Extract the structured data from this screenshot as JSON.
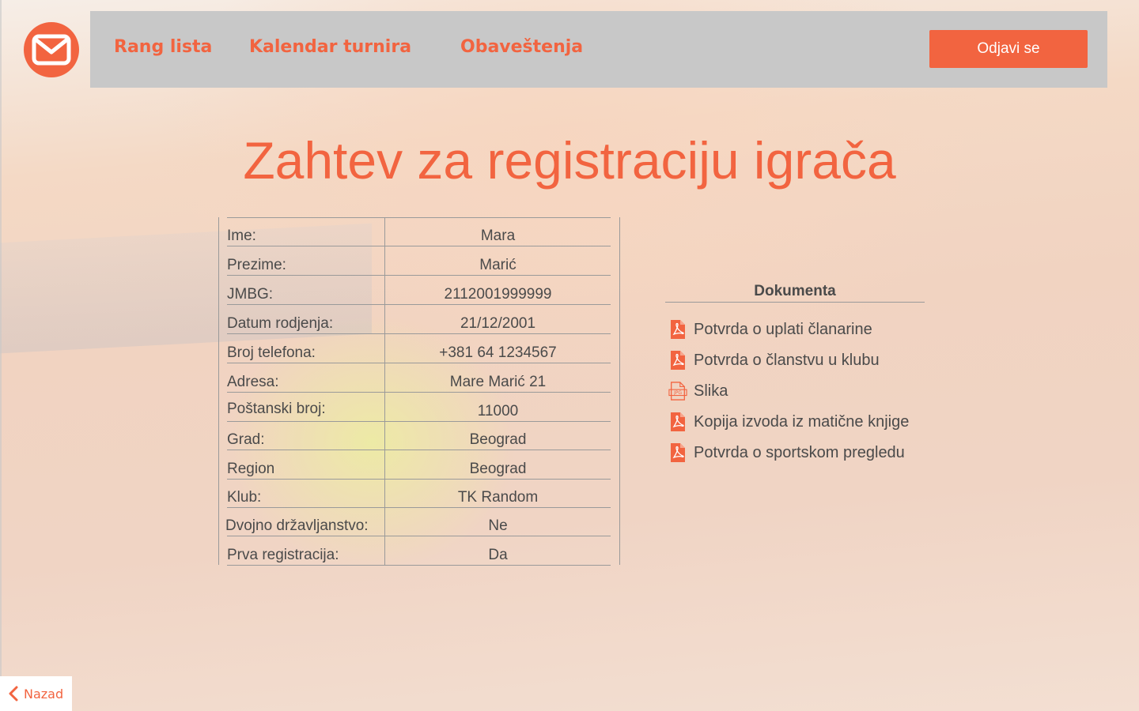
{
  "colors": {
    "accent": "#f26440",
    "navbar_bg": "#c8c8c8",
    "text": "#4a4a4a"
  },
  "header": {
    "logo_icon": "envelope-icon",
    "nav": [
      {
        "label": "Rang lista"
      },
      {
        "label": "Kalendar turnira"
      },
      {
        "label": "Obaveštenja"
      }
    ],
    "logout_label": "Odjavi se"
  },
  "page": {
    "title": "Zahtev za registraciju igrača"
  },
  "player": {
    "rows": [
      {
        "label": "Ime:",
        "value": "Mara"
      },
      {
        "label": "Prezime:",
        "value": "Marić"
      },
      {
        "label": "JMBG:",
        "value": "2112001999999"
      },
      {
        "label": "Datum rodjenja:",
        "value": "21/12/2001"
      },
      {
        "label": "Broj telefona:",
        "value": "+381 64 1234567"
      },
      {
        "label": "Adresa:",
        "value": "Mare Marić 21"
      },
      {
        "label": "Poštanski broj:",
        "value": "11000"
      },
      {
        "label": "Grad:",
        "value": "Beograd"
      },
      {
        "label": "Region",
        "value": "Beograd"
      },
      {
        "label": "Klub:",
        "value": "TK Random"
      },
      {
        "label": "Dvojno državljanstvo:",
        "value": "Ne"
      },
      {
        "label": "Prva registracija:",
        "value": "Da"
      }
    ]
  },
  "documents": {
    "title": "Dokumenta",
    "items": [
      {
        "name": "Potvrda o uplati članarine",
        "icon": "pdf-icon"
      },
      {
        "name": "Potvrda o članstvu u klubu",
        "icon": "pdf-icon"
      },
      {
        "name": "Slika",
        "icon": "jpg-icon"
      },
      {
        "name": "Kopija izvoda iz matične knjige",
        "icon": "pdf-icon"
      },
      {
        "name": "Potvrda o sportskom pregledu",
        "icon": "pdf-icon"
      }
    ],
    "jpg_badge": "JPG"
  },
  "footer": {
    "back_label": "Nazad",
    "back_icon": "chevron-left-icon"
  }
}
